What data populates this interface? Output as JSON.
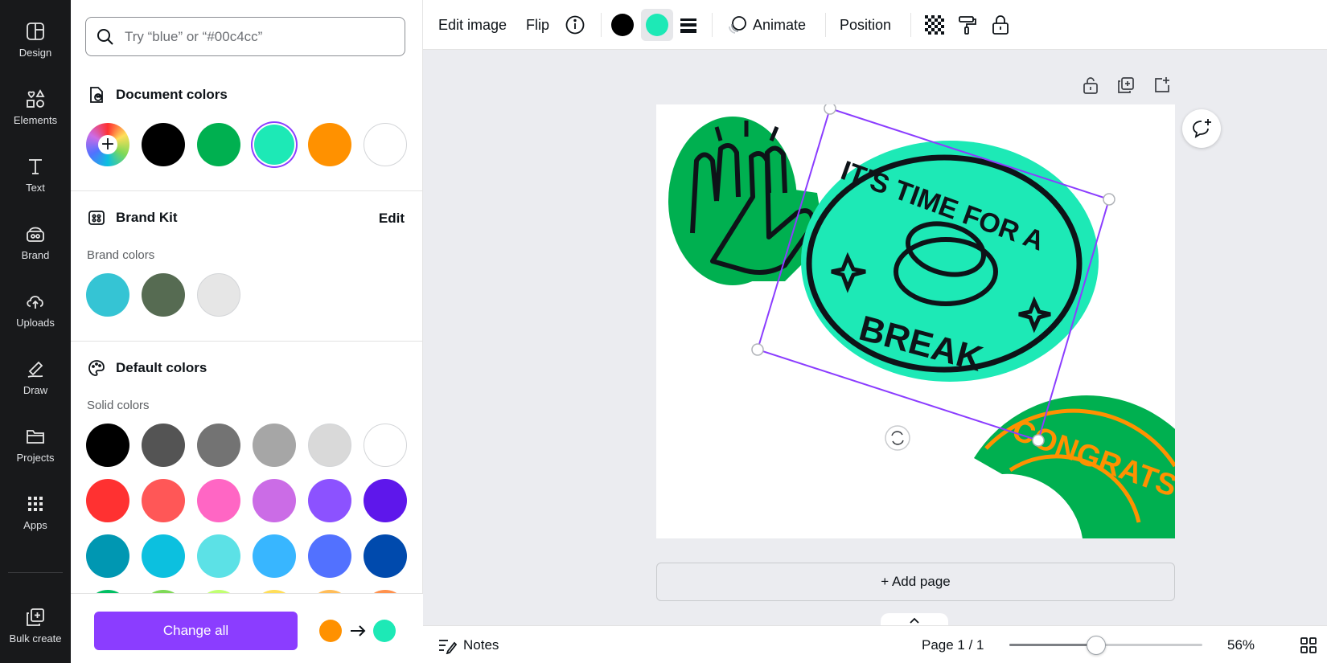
{
  "rail": {
    "items": [
      {
        "label": "Design",
        "icon": "design-icon"
      },
      {
        "label": "Elements",
        "icon": "elements-icon"
      },
      {
        "label": "Text",
        "icon": "text-icon"
      },
      {
        "label": "Brand",
        "icon": "brand-icon"
      },
      {
        "label": "Uploads",
        "icon": "uploads-icon"
      },
      {
        "label": "Draw",
        "icon": "draw-icon"
      },
      {
        "label": "Projects",
        "icon": "projects-icon"
      },
      {
        "label": "Apps",
        "icon": "apps-icon"
      },
      {
        "label": "Bulk create",
        "icon": "bulk-create-icon"
      }
    ]
  },
  "panel": {
    "search_placeholder": "Try “blue” or “#00c4cc”",
    "document_colors": {
      "title": "Document colors",
      "swatches": [
        "add-color",
        "#000000",
        "#00b050",
        "#1de9b6",
        "#ff9100",
        "#ffffff"
      ],
      "selected": "#1de9b6"
    },
    "brand_kit": {
      "title": "Brand Kit",
      "edit_label": "Edit",
      "subtitle": "Brand colors",
      "swatches": [
        "#35c4d4",
        "#566b52",
        "#e6e6e6"
      ]
    },
    "default_colors": {
      "title": "Default colors",
      "subtitle": "Solid colors",
      "rows": [
        [
          "#000000",
          "#545454",
          "#737373",
          "#a6a6a6",
          "#d9d9d9",
          "#ffffff"
        ],
        [
          "#ff3131",
          "#ff5757",
          "#ff66c4",
          "#cb6ce6",
          "#8c52ff",
          "#5e17eb"
        ],
        [
          "#0097b2",
          "#0cc0df",
          "#5ce1e6",
          "#38b6ff",
          "#5271ff",
          "#004aad"
        ],
        [
          "#00bf63",
          "#7ed957",
          "#c1ff72",
          "#ffde59",
          "#ffbd59",
          "#ff914d"
        ]
      ]
    },
    "change_all_label": "Change all",
    "replace_from": "#ff9100",
    "replace_to": "#1de9b6"
  },
  "toolbar": {
    "edit_image": "Edit image",
    "flip": "Flip",
    "animate": "Animate",
    "position": "Position",
    "color_one": "#000000",
    "color_two": "#1de9b6"
  },
  "canvas": {
    "sticker_break_text_top": "IT'S TIME FOR A",
    "sticker_break_text_bottom": "BREAK",
    "sticker_congrats_text": "CONGRATS",
    "add_page_label": "+ Add page"
  },
  "footer": {
    "notes_label": "Notes",
    "page_label": "Page 1 / 1",
    "zoom_label": "56%",
    "zoom_fraction": 0.45
  }
}
